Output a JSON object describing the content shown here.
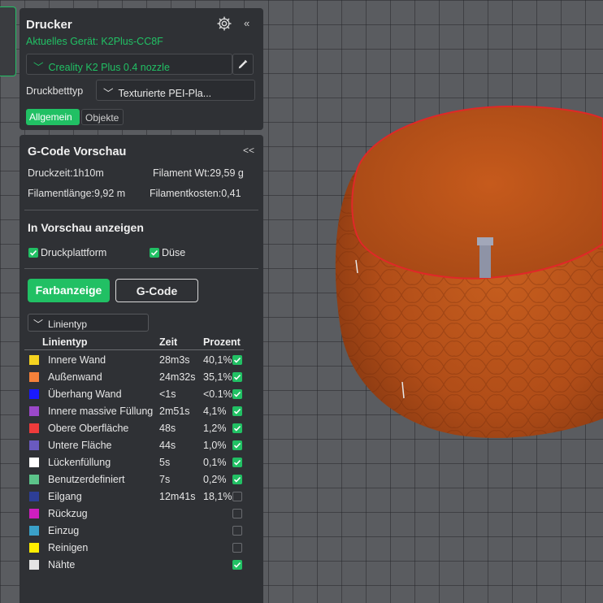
{
  "printer_panel": {
    "title": "Drucker",
    "device": "Aktuelles Gerät: K2Plus-CC8F",
    "nozzle": "Creality K2 Plus 0.4 nozzle",
    "bed_label": "Druckbetttyp",
    "bed_value": "Texturierte PEI-Pla...",
    "tabs": [
      "Allgemein",
      "Objekte"
    ],
    "active_tab": "Allgemein",
    "collapse_glyph": "«",
    "icons": [
      "gear-icon",
      "pencil-icon",
      "chevron-down-icon"
    ]
  },
  "gcode_panel": {
    "title": "G-Code Vorschau",
    "collapse_glyph": "<<",
    "print_time": "Druckzeit:1h10m",
    "filament_weight": "Filament Wt:29,59 g",
    "filament_length": "Filamentlänge:9,92 m",
    "filament_cost": "Filamentkosten:0,41",
    "preview_section_title": "In Vorschau anzeigen",
    "show_plate_label": "Druckplattform",
    "show_plate_checked": true,
    "show_nozzle_label": "Düse",
    "show_nozzle_checked": true,
    "btn_color": "Farbanzeige",
    "btn_gcode": "G-Code",
    "line_select": "Linientyp",
    "headers": {
      "type": "Linientyp",
      "time": "Zeit",
      "percent": "Prozent"
    },
    "rows": [
      {
        "name": "Innere Wand",
        "time": "28m3s",
        "percent": "40,1%",
        "color": "#f5d31f",
        "checked": true
      },
      {
        "name": "Außenwand",
        "time": "24m32s",
        "percent": "35,1%",
        "color": "#f5813a",
        "checked": true
      },
      {
        "name": "Überhang Wand",
        "time": "<1s",
        "percent": "<0.1%",
        "color": "#1a1aff",
        "checked": true
      },
      {
        "name": "Innere massive Füllung",
        "time": "2m51s",
        "percent": "4,1%",
        "color": "#9b48c9",
        "checked": true
      },
      {
        "name": "Obere Oberfläche",
        "time": "48s",
        "percent": "1,2%",
        "color": "#ee3b3b",
        "checked": true
      },
      {
        "name": "Untere Fläche",
        "time": "44s",
        "percent": "1,0%",
        "color": "#6a5ac0",
        "checked": true
      },
      {
        "name": "Lückenfüllung",
        "time": "5s",
        "percent": "0,1%",
        "color": "#ffffff",
        "checked": true
      },
      {
        "name": "Benutzerdefiniert",
        "time": "7s",
        "percent": "0,2%",
        "color": "#5cc48a",
        "checked": true
      },
      {
        "name": "Eilgang",
        "time": "12m41s",
        "percent": "18,1%",
        "color": "#2d3e96",
        "checked": false
      },
      {
        "name": "Rückzug",
        "time": "",
        "percent": "",
        "color": "#d01ec0",
        "checked": false
      },
      {
        "name": "Einzug",
        "time": "",
        "percent": "",
        "color": "#3aa0c8",
        "checked": false
      },
      {
        "name": "Reinigen",
        "time": "",
        "percent": "",
        "color": "#ffee00",
        "checked": false
      },
      {
        "name": "Nähte",
        "time": "",
        "percent": "",
        "color": "#e4e4e4",
        "checked": true
      }
    ]
  },
  "colors": {
    "accent": "#21c064",
    "panel": "#2f3135",
    "model": "#c45a1e",
    "model_rim": "#e02828",
    "grid_bg": "#5a5c60"
  }
}
